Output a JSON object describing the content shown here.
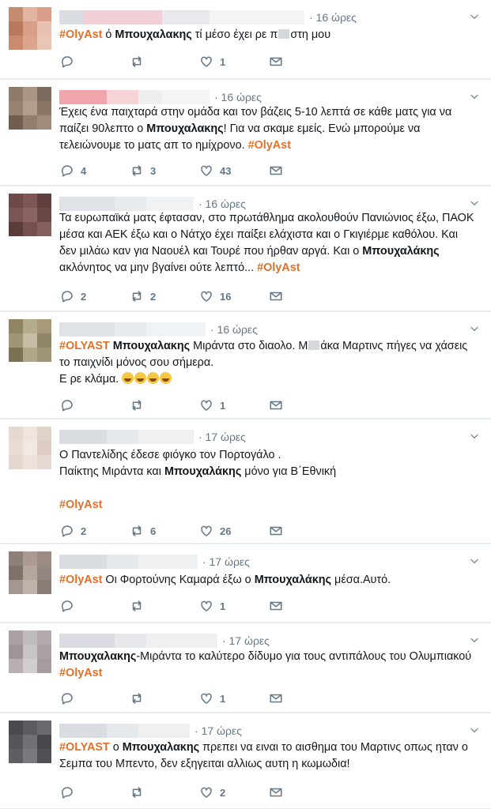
{
  "tweets": [
    {
      "time": "· 16 ώρες",
      "segments": [
        {
          "t": "tag",
          "v": "#OlyAst"
        },
        {
          "t": "txt",
          "v": " ό "
        },
        {
          "t": "b",
          "v": "Μπουχαλακης"
        },
        {
          "t": "txt",
          "v": "  τί μέσο έχει ρε π"
        },
        {
          "t": "censor"
        },
        {
          "t": "txt",
          "v": "στη μου"
        }
      ],
      "reply": "",
      "retweet": "",
      "like": "1",
      "avatar": [
        "#c48b6f",
        "#e2b5a0",
        "#d8a08c",
        "#b9795f",
        "#d89e86",
        "#e8c2b0",
        "#c98a70",
        "#dca48d",
        "#e9c6b5"
      ],
      "name_blocks": [
        "#d9dde1",
        "#f2cfd6",
        "#e7e9ec",
        "#f3f4f6"
      ]
    },
    {
      "time": "· 16 ώρες",
      "segments": [
        {
          "t": "txt",
          "v": "Έχεις ένα παιχταρά στην ομάδα και τον βάζεις 5-10 λεπτά σε κάθε ματς για να παίζει 90λεπτο ο "
        },
        {
          "t": "b",
          "v": "Μπουχαλακης"
        },
        {
          "t": "txt",
          "v": "! Για να σκαμε εμείς. Ενώ μπορούμε να τελειώνουμε το ματς απ το ημίχρονο.  "
        },
        {
          "t": "tag",
          "v": "#OlyAst"
        }
      ],
      "reply": "4",
      "retweet": "3",
      "like": "43",
      "avatar": [
        "#8c7a6a",
        "#a89585",
        "#7d6b5d",
        "#96826f",
        "#b09d8b",
        "#8a7665",
        "#6f5d50",
        "#927e6c",
        "#a08c7a"
      ],
      "name_blocks": [
        "#f0a5ad",
        "#f6d3d8",
        "#eceef0",
        "#f3f4f6"
      ]
    },
    {
      "time": "· 16 ώρες",
      "segments": [
        {
          "t": "txt",
          "v": "Τα ευρωπαϊκά ματς έφτασαν, στο πρωτάθλημα ακολουθούν Πανιώνιος έξω, ΠΑΟΚ μέσα και ΑΕΚ έξω και ο Νάτχο έχει παίξει ελάχιστα και ο Γκιγιέρμε καθόλου. Και δεν μιλάω καν για Ναουέλ και Τουρέ που ήρθαν αργά. Και ο "
        },
        {
          "t": "b",
          "v": "Μπουχαλάκης"
        },
        {
          "t": "txt",
          "v": " ακλόνητος να μην βγαίνει ούτε λεπτό... "
        },
        {
          "t": "tag",
          "v": "#OlyAst"
        }
      ],
      "reply": "2",
      "retweet": "2",
      "like": "16",
      "avatar": [
        "#6d4a48",
        "#7e5654",
        "#5f3f3e",
        "#7a5553",
        "#8b6360",
        "#694746",
        "#5a3c3b",
        "#745150",
        "#83605d"
      ],
      "name_blocks": [
        "#dfe3e7",
        "#e8ebee",
        "#f0f2f4"
      ]
    },
    {
      "time": "· 16 ώρες",
      "segments": [
        {
          "t": "tag",
          "v": "#OLYAST"
        },
        {
          "t": "txt",
          "v": " "
        },
        {
          "t": "b",
          "v": "Μπουχαλακης"
        },
        {
          "t": "txt",
          "v": " Μιράντα στο διαολο. Μ"
        },
        {
          "t": "censor"
        },
        {
          "t": "txt",
          "v": "άκα Μαρτινς πήγες να χάσεις το παιχνίδι μόνος σου σήμερα.\nΕ ρε κλάμα. "
        },
        {
          "t": "emoji"
        },
        {
          "t": "emoji"
        },
        {
          "t": "emoji"
        },
        {
          "t": "emoji"
        }
      ],
      "reply": "",
      "retweet": "",
      "like": "1",
      "avatar": [
        "#8f8464",
        "#b5ab8e",
        "#a7997a",
        "#a09677",
        "#c6bda3",
        "#8e8468",
        "#7c7155",
        "#b0a68a",
        "#9f9476"
      ],
      "name_blocks": [
        "#dfe3e7",
        "#e8ebee",
        "#f0f2f4"
      ]
    },
    {
      "time": "· 17 ώρες",
      "segments": [
        {
          "t": "txt",
          "v": "Ο Παντελίδης έδεσε φιόγκο τον Πορτογάλο .\nΠαίκτης Μιράντα και "
        },
        {
          "t": "b",
          "v": "Μπουχαλάκης"
        },
        {
          "t": "txt",
          "v": " μόνο για Β΄Εθνική\n\n"
        },
        {
          "t": "tag",
          "v": "#OlyAst"
        }
      ],
      "reply": "2",
      "retweet": "6",
      "like": "26",
      "avatar": [
        "#e6d9d2",
        "#efe4de",
        "#e0d1c9",
        "#eadcd4",
        "#f3e9e4",
        "#ddccc3",
        "#e4d5cd",
        "#eee2db",
        "#e8dad2"
      ],
      "name_blocks": [
        "#d9dde1",
        "#e6e9ec",
        "#eef0f2"
      ]
    },
    {
      "time": "· 17 ώρες",
      "segments": [
        {
          "t": "tag",
          "v": "#OlyAst"
        },
        {
          "t": "txt",
          "v": " Οι Φορτούνης Καμαρά έξω ο "
        },
        {
          "t": "b",
          "v": "Μπουχαλάκης"
        },
        {
          "t": "txt",
          "v": " μέσα.Αυτό."
        }
      ],
      "reply": "",
      "retweet": "",
      "like": "1",
      "avatar": [
        "#8e8078",
        "#aa9a91",
        "#9b8b83",
        "#7f7169",
        "#b4a59d",
        "#948680",
        "#a49690",
        "#c0b2ab",
        "#8a7c74"
      ],
      "name_blocks": [
        "#d9dde1",
        "#e6e9ec",
        "#eef0f2"
      ]
    },
    {
      "time": "· 17 ώρες",
      "segments": [
        {
          "t": "b",
          "v": "Μπουχαλακης"
        },
        {
          "t": "txt",
          "v": "-Μιράντα το καλύτερο δίδυμο για τους αντιπάλους του Ολυμπιακού "
        },
        {
          "t": "tag",
          "v": "#OlyAst"
        }
      ],
      "reply": "",
      "retweet": "",
      "like": "1",
      "avatar": [
        "#a8a0a4",
        "#c2bbbe",
        "#b3abaf",
        "#9d9599",
        "#cbc4c7",
        "#aaa2a6",
        "#b7afb3",
        "#d3cdd0",
        "#a49ca0"
      ],
      "name_blocks": [
        "#d9dde1",
        "#e6e9ec",
        "#eef0f2"
      ]
    },
    {
      "time": "· 17 ώρες",
      "segments": [
        {
          "t": "tag",
          "v": "#OLYAST"
        },
        {
          "t": "txt",
          "v": " ο "
        },
        {
          "t": "b",
          "v": "Μπουχαλακης"
        },
        {
          "t": "txt",
          "v": " πρεπει να ειναι το αισθημα του Μαρτινς οπως ηταν ο Σεμπα του Μπεντο, δεν εξηγειται αλλιως αυτη η κωμωδια!"
        }
      ],
      "reply": "",
      "retweet": "",
      "like": "2",
      "avatar": [
        "#4a4a4e",
        "#5c5c60",
        "#6a6a6e",
        "#55555a",
        "#707075",
        "#48484c",
        "#5f5f63",
        "#7a7a7e",
        "#505054"
      ],
      "name_blocks": [
        "#d9dde1",
        "#e6e9ec",
        "#eef0f2"
      ]
    }
  ]
}
